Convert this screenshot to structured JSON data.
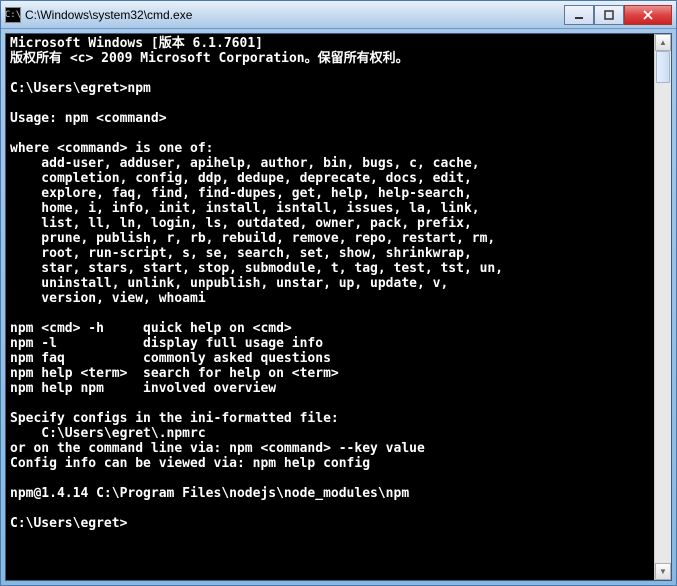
{
  "window": {
    "title": "C:\\Windows\\system32\\cmd.exe",
    "icon_label": "C:\\"
  },
  "terminal": {
    "lines": [
      "Microsoft Windows [版本 6.1.7601]",
      "版权所有 <c> 2009 Microsoft Corporation。保留所有权利。",
      "",
      "C:\\Users\\egret>npm",
      "",
      "Usage: npm <command>",
      "",
      "where <command> is one of:",
      "    add-user, adduser, apihelp, author, bin, bugs, c, cache,",
      "    completion, config, ddp, dedupe, deprecate, docs, edit,",
      "    explore, faq, find, find-dupes, get, help, help-search,",
      "    home, i, info, init, install, isntall, issues, la, link,",
      "    list, ll, ln, login, ls, outdated, owner, pack, prefix,",
      "    prune, publish, r, rb, rebuild, remove, repo, restart, rm,",
      "    root, run-script, s, se, search, set, show, shrinkwrap,",
      "    star, stars, start, stop, submodule, t, tag, test, tst, un,",
      "    uninstall, unlink, unpublish, unstar, up, update, v,",
      "    version, view, whoami",
      "",
      "npm <cmd> -h     quick help on <cmd>",
      "npm -l           display full usage info",
      "npm faq          commonly asked questions",
      "npm help <term>  search for help on <term>",
      "npm help npm     involved overview",
      "",
      "Specify configs in the ini-formatted file:",
      "    C:\\Users\\egret\\.npmrc",
      "or on the command line via: npm <command> --key value",
      "Config info can be viewed via: npm help config",
      "",
      "npm@1.4.14 C:\\Program Files\\nodejs\\node_modules\\npm",
      "",
      "C:\\Users\\egret>"
    ]
  }
}
